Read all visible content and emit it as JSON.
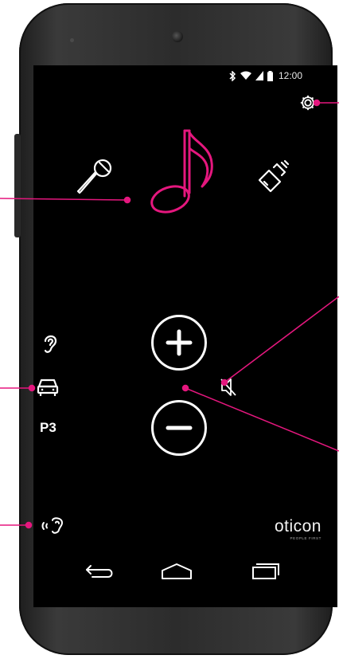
{
  "status_bar": {
    "time": "12:00",
    "icons": [
      "bluetooth-icon",
      "wifi-icon",
      "signal-icon",
      "battery-icon"
    ]
  },
  "header": {
    "settings_icon": "gear-icon"
  },
  "modes": [
    {
      "icon": "microphone-icon",
      "selected": false
    },
    {
      "icon": "music-note-icon",
      "selected": true
    },
    {
      "icon": "tv-streamer-icon",
      "selected": false
    }
  ],
  "volume": {
    "up_icon": "plus-icon",
    "down_icon": "minus-icon",
    "mute_icon": "speaker-mute-icon"
  },
  "program": {
    "ear_icon": "ear-icon",
    "car_icon": "car-icon",
    "label": "P3"
  },
  "remote_icon": "hearing-aid-remote-icon",
  "brand": {
    "name": "oticon",
    "tagline": "PEOPLE FIRST"
  },
  "nav_bar": [
    "back-icon",
    "home-icon",
    "recents-icon"
  ],
  "colors": {
    "accent": "#e5177e",
    "screen_bg": "#000000",
    "icon": "#ffffff",
    "device_body": "#2c2c2c"
  }
}
